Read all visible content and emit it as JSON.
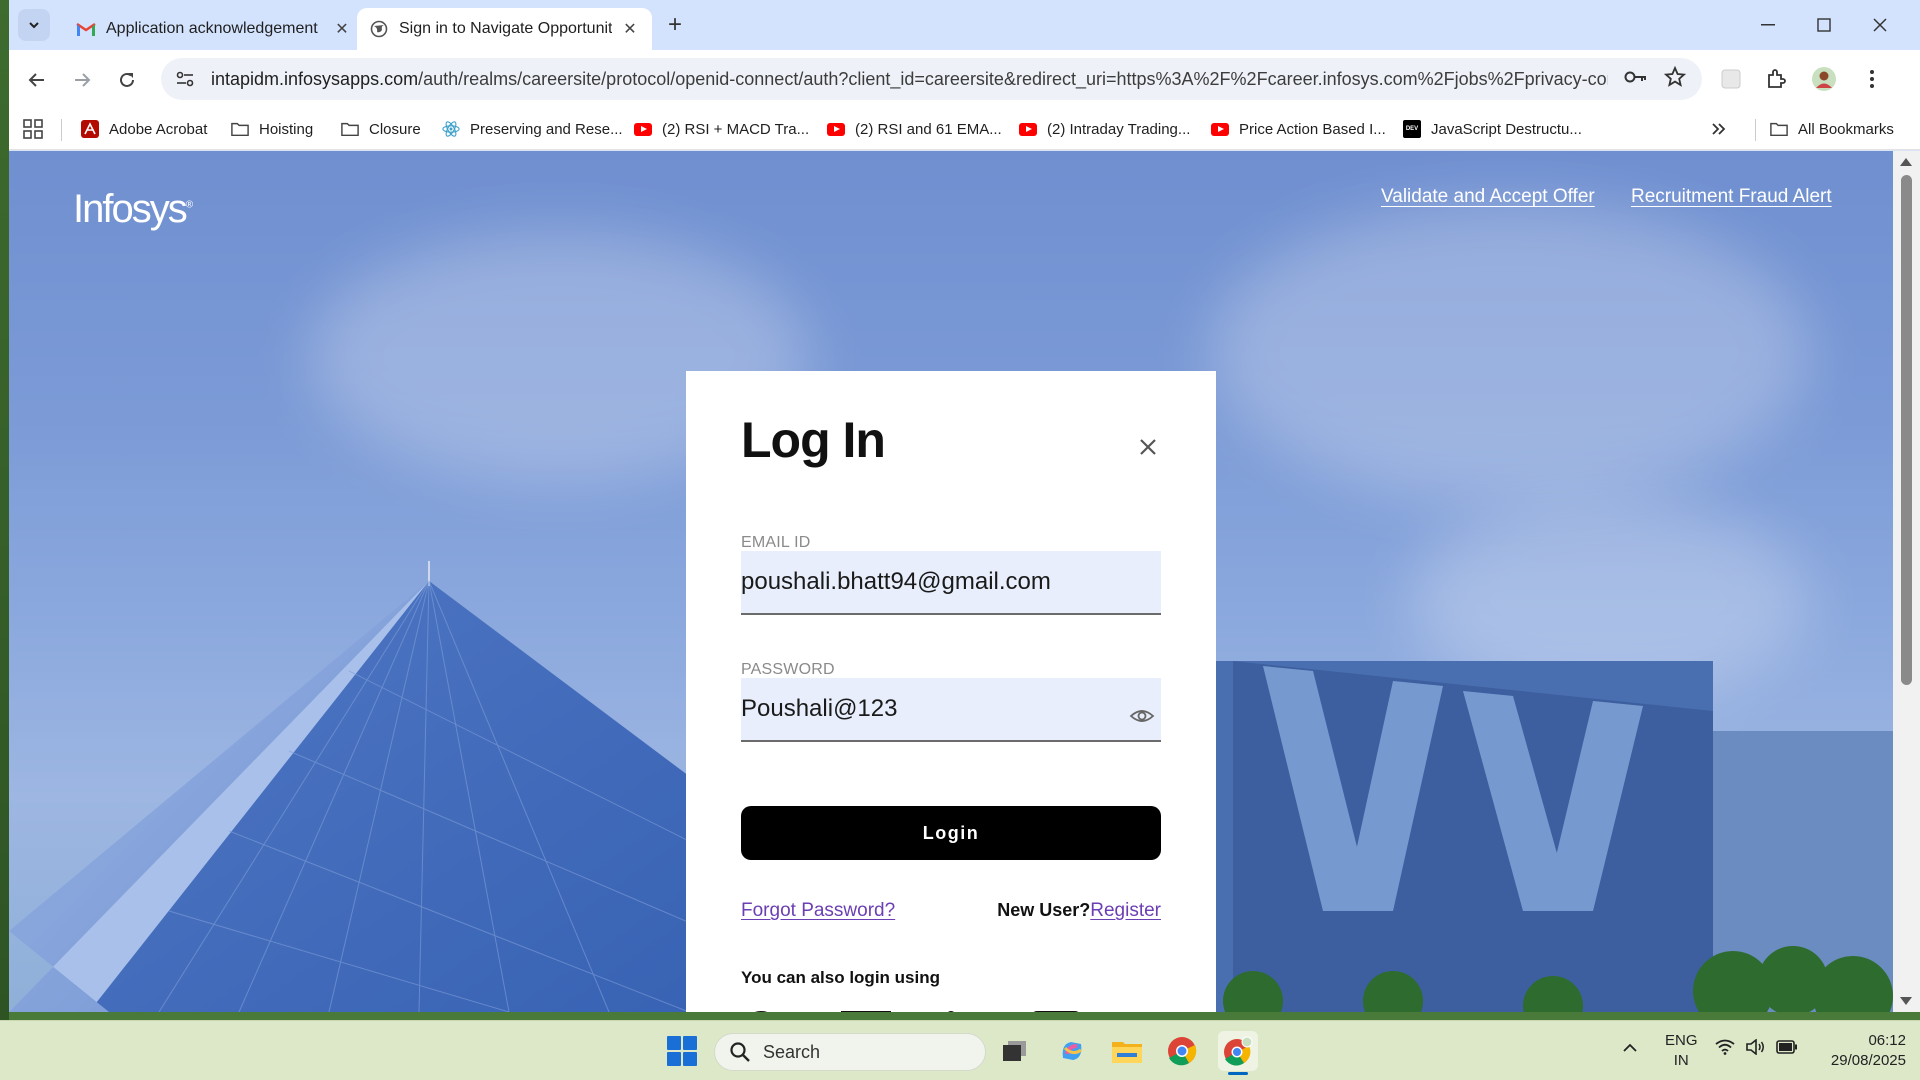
{
  "browser": {
    "tabs": [
      {
        "title": "Application acknowledgement",
        "favicon": "gmail-icon",
        "active": false
      },
      {
        "title": "Sign in to Navigate Opportuniti",
        "favicon": "globe-icon",
        "active": true
      }
    ],
    "url_host": "intapidm.infosysapps.com",
    "url_rest": "/auth/realms/careersite/protocol/openid-connect/auth?client_id=careersite&redirect_uri=https%3A%2F%2Fcareer.infosys.com%2Fjobs%2Fprivacy-conse...",
    "bookmarks": [
      {
        "label": "Adobe Acrobat",
        "icon": "acrobat-icon"
      },
      {
        "label": "Hoisting",
        "icon": "folder-icon"
      },
      {
        "label": "Closure",
        "icon": "folder-icon"
      },
      {
        "label": "Preserving and Rese...",
        "icon": "react-icon"
      },
      {
        "label": "(2) RSI + MACD Tra...",
        "icon": "youtube-icon"
      },
      {
        "label": "(2) RSI and 61 EMA...",
        "icon": "youtube-icon"
      },
      {
        "label": "(2) Intraday Trading...",
        "icon": "youtube-icon"
      },
      {
        "label": "Price Action Based I...",
        "icon": "youtube-icon"
      },
      {
        "label": "JavaScript Destructu...",
        "icon": "dev-icon"
      }
    ],
    "all_bookmarks": "All Bookmarks"
  },
  "page": {
    "logo": "Infosys",
    "links": {
      "validate": "Validate and Accept Offer",
      "fraud": "Recruitment Fraud Alert"
    },
    "login": {
      "title": "Log In",
      "email_label": "EMAIL ID",
      "email_value": "poushali.bhatt94@gmail.com",
      "password_label": "PASSWORD",
      "password_value": "Poushali@123",
      "login_button": "Login",
      "forgot": "Forgot Password?",
      "new_user": "New User?",
      "register": "Register",
      "also_login": "You can also login using"
    }
  },
  "taskbar": {
    "search_placeholder": "Search",
    "lang_top": "ENG",
    "lang_bottom": "IN",
    "time": "06:12",
    "date": "29/08/2025"
  },
  "colors": {
    "accent_link": "#6b3fb3",
    "login_button_bg": "#000000",
    "field_bg": "#e8eefb",
    "tabstrip_bg": "#d3e3fd",
    "taskbar_bg": "#dde8c9"
  }
}
